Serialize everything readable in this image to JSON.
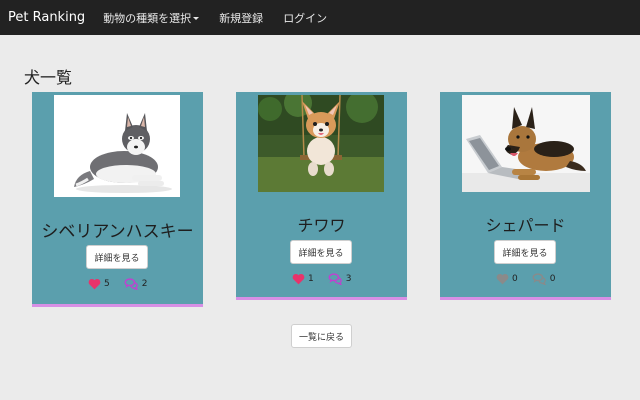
{
  "navbar": {
    "brand": "Pet Ranking",
    "dropdown_label": "動物の種類を選択",
    "register_label": "新規登録",
    "login_label": "ログイン"
  },
  "page": {
    "title": "犬一覧"
  },
  "colors": {
    "navbar_bg": "#222222",
    "card_bg": "#5b9fad",
    "card_border": "#d78fe5",
    "like_active": "#e8336b",
    "comment_active": "#c23fd1",
    "icon_inactive": "#8a8a8a"
  },
  "dogs": [
    {
      "name": "シベリアンハスキー",
      "detail_label": "詳細を見る",
      "likes": "5",
      "comments": "2",
      "like_icon": "heart-icon",
      "comment_icon": "comments-icon"
    },
    {
      "name": "チワワ",
      "detail_label": "詳細を見る",
      "likes": "1",
      "comments": "3",
      "like_icon": "heart-icon",
      "comment_icon": "comments-icon"
    },
    {
      "name": "シェパード",
      "detail_label": "詳細を見る",
      "likes": "0",
      "comments": "0",
      "like_icon": "heart-icon",
      "comment_icon": "comments-icon"
    }
  ],
  "back_label": "一覧に戻る"
}
